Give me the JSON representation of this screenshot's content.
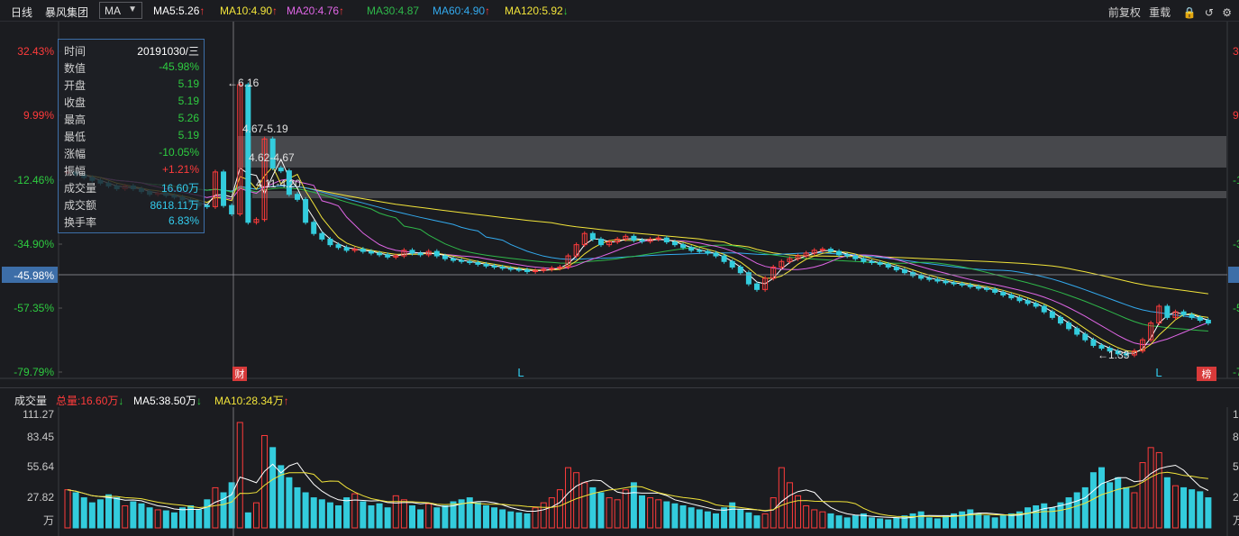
{
  "toolbar": {
    "period": "日线",
    "stock": "暴风集团",
    "indicator": "MA",
    "ma": [
      {
        "label": "MA5:5.26",
        "arrow": "↑",
        "color": "#ffffff"
      },
      {
        "label": "MA10:4.90",
        "arrow": "↑",
        "color": "#f2e43a"
      },
      {
        "label": "MA20:4.76",
        "arrow": "↑",
        "color": "#e066e6"
      },
      {
        "label": "MA30:4.87",
        "arrow": "",
        "color": "#2fb84a"
      },
      {
        "label": "MA60:4.90",
        "arrow": "↑",
        "color": "#33aaee"
      },
      {
        "label": "MA120:5.92",
        "arrow": "↓",
        "color": "#f2e43a"
      }
    ],
    "right": [
      "前复权",
      "重载"
    ]
  },
  "tooltip": {
    "rows": [
      {
        "k": "时间",
        "v": "20191030/三",
        "color": "#ffffff"
      },
      {
        "k": "数值",
        "v": "-45.98%",
        "color": "#2ecc40"
      },
      {
        "k": "开盘",
        "v": "5.19",
        "color": "#2ecc40"
      },
      {
        "k": "收盘",
        "v": "5.19",
        "color": "#2ecc40"
      },
      {
        "k": "最高",
        "v": "5.26",
        "color": "#2ecc40"
      },
      {
        "k": "最低",
        "v": "5.19",
        "color": "#2ecc40"
      },
      {
        "k": "涨幅",
        "v": "-10.05%",
        "color": "#2ecc40"
      },
      {
        "k": "振幅",
        "v": "+1.21%",
        "color": "#ff3b3b"
      },
      {
        "k": "成交量",
        "v": "16.60万",
        "color": "#33ccee"
      },
      {
        "k": "成交额",
        "v": "8618.11万",
        "color": "#33ccee"
      },
      {
        "k": "换手率",
        "v": "6.83%",
        "color": "#33ccee"
      }
    ]
  },
  "volume_bar": {
    "title": "成交量",
    "total": "总量:16.60万",
    "total_arrow": "↓",
    "ma5": "MA5:38.50万",
    "ma5_arrow": "↓",
    "ma10": "MA10:28.34万",
    "ma10_arrow": "↑"
  },
  "chart_data": [
    {
      "type": "candlestick",
      "y_axis_left_ticks": [
        "32.43%",
        "9.99%",
        "-12.46%",
        "-34.90%",
        "-57.35%",
        "-79.79%"
      ],
      "y_axis_right_ticks_partial": [
        "3",
        "9",
        "-1",
        "-3",
        "-5",
        "-7"
      ],
      "crosshair_label": "-45.98%",
      "annotations": [
        "←6.16",
        "4.67-5.19",
        "4.62-4.67",
        "4.11-4.20",
        "←1.33",
        "财",
        "L",
        "L",
        "榜"
      ],
      "gap_zones": [
        {
          "range": "4.67-5.19"
        },
        {
          "range": "4.11-4.20"
        }
      ],
      "price_range": [
        1.33,
        6.16
      ],
      "candles_close": [
        4.6,
        4.55,
        4.5,
        4.45,
        4.4,
        4.35,
        4.3,
        4.35,
        4.3,
        4.25,
        4.2,
        4.22,
        4.18,
        4.15,
        4.1,
        4.05,
        4.0,
        3.98,
        4.6,
        4.0,
        3.85,
        6.16,
        3.7,
        3.75,
        5.19,
        4.67,
        4.62,
        4.2,
        4.11,
        3.7,
        3.5,
        3.4,
        3.3,
        3.25,
        3.2,
        3.22,
        3.18,
        3.15,
        3.12,
        3.08,
        3.1,
        3.2,
        3.15,
        3.12,
        3.18,
        3.1,
        3.05,
        3.02,
        3.0,
        2.98,
        2.95,
        2.92,
        2.9,
        2.88,
        2.86,
        2.85,
        2.82,
        2.84,
        2.86,
        2.88,
        2.9,
        3.1,
        3.3,
        3.5,
        3.4,
        3.3,
        3.35,
        3.4,
        3.45,
        3.38,
        3.36,
        3.4,
        3.42,
        3.35,
        3.3,
        3.25,
        3.2,
        3.18,
        3.15,
        3.1,
        3.0,
        2.9,
        2.8,
        2.6,
        2.5,
        2.7,
        2.9,
        3.0,
        3.05,
        3.1,
        3.15,
        3.2,
        3.22,
        3.18,
        3.12,
        3.1,
        3.05,
        3.0,
        2.98,
        2.95,
        2.9,
        2.85,
        2.8,
        2.75,
        2.7,
        2.68,
        2.65,
        2.62,
        2.6,
        2.58,
        2.55,
        2.52,
        2.5,
        2.45,
        2.4,
        2.35,
        2.3,
        2.25,
        2.2,
        2.1,
        2.0,
        1.9,
        1.8,
        1.7,
        1.6,
        1.5,
        1.45,
        1.4,
        1.35,
        1.33,
        1.4,
        1.6,
        1.9,
        2.2,
        2.0,
        2.1,
        2.05,
        2.0,
        1.95,
        1.9
      ]
    },
    {
      "type": "bar",
      "title": "成交量",
      "y_axis_left_ticks": [
        "111.27",
        "83.45",
        "55.64",
        "27.82",
        "万"
      ],
      "y_axis_right_ticks_partial": [
        "1",
        "8",
        "5",
        "2",
        "万"
      ],
      "ylim": [
        0,
        111.27
      ],
      "values": [
        38,
        35,
        30,
        25,
        28,
        33,
        30,
        22,
        26,
        24,
        20,
        18,
        17,
        15,
        20,
        22,
        18,
        28,
        40,
        35,
        45,
        105,
        15,
        25,
        92,
        80,
        62,
        50,
        40,
        35,
        30,
        28,
        25,
        22,
        30,
        34,
        26,
        22,
        24,
        20,
        32,
        28,
        22,
        18,
        24,
        20,
        22,
        26,
        28,
        30,
        25,
        22,
        20,
        18,
        16,
        15,
        14,
        20,
        25,
        30,
        38,
        60,
        55,
        45,
        40,
        35,
        30,
        28,
        38,
        45,
        32,
        30,
        28,
        26,
        24,
        22,
        20,
        18,
        16,
        14,
        20,
        25,
        18,
        15,
        12,
        14,
        30,
        60,
        45,
        32,
        22,
        18,
        16,
        14,
        12,
        10,
        12,
        14,
        10,
        9,
        8,
        10,
        12,
        14,
        16,
        10,
        9,
        12,
        14,
        16,
        18,
        14,
        12,
        10,
        12,
        14,
        16,
        20,
        22,
        24,
        20,
        25,
        30,
        35,
        40,
        55,
        60,
        45,
        50,
        40,
        35,
        65,
        80,
        75,
        50,
        42,
        40,
        38,
        36,
        30
      ]
    }
  ]
}
